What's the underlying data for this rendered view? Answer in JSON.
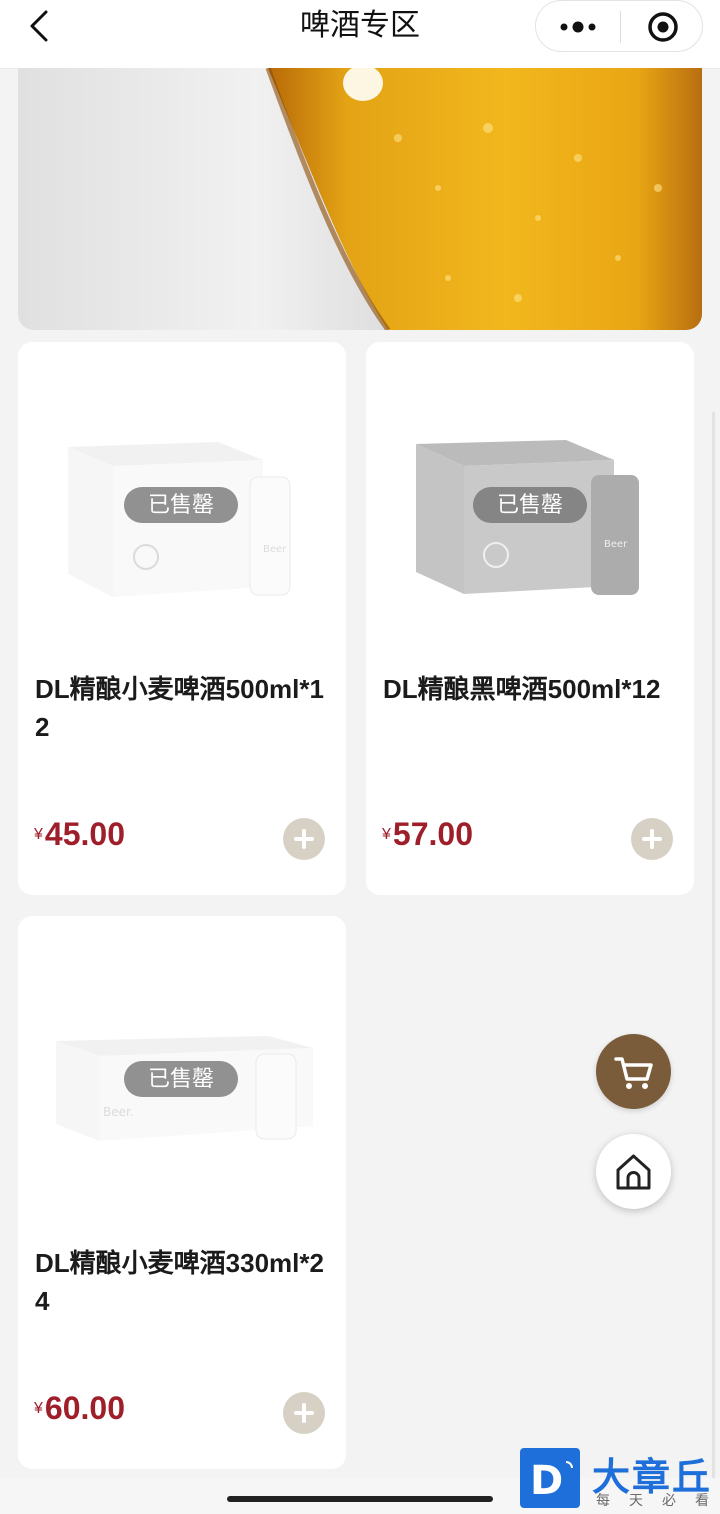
{
  "header": {
    "title": "啤酒专区",
    "back_icon": "chevron-left-icon",
    "more_icon": "more-dots-icon",
    "close_icon": "target-close-icon"
  },
  "banner": {
    "image": "beer-glass-photo"
  },
  "products": [
    {
      "name": "DL精酿小麦啤酒500ml*12",
      "currency": "¥",
      "price": "45.00",
      "status": "已售罄",
      "image": "white-box-and-can"
    },
    {
      "name": "DL精酿黑啤酒500ml*12",
      "currency": "¥",
      "price": "57.00",
      "status": "已售罄",
      "image": "dark-box-and-can"
    },
    {
      "name": "DL精酿小麦啤酒330ml*24",
      "currency": "¥",
      "price": "60.00",
      "status": "已售罄",
      "image": "white-flat-box-and-can"
    }
  ],
  "floating": {
    "cart_icon": "cart-icon",
    "home_icon": "home-icon"
  },
  "watermark": {
    "badge_letter": "D",
    "name": "大章丘",
    "slogan": "每天必看"
  },
  "colors": {
    "price": "#9e1e2a",
    "add_button": "#d6d0c5",
    "cart_button": "#7a5c3a",
    "watermark": "#1e6fd9"
  }
}
